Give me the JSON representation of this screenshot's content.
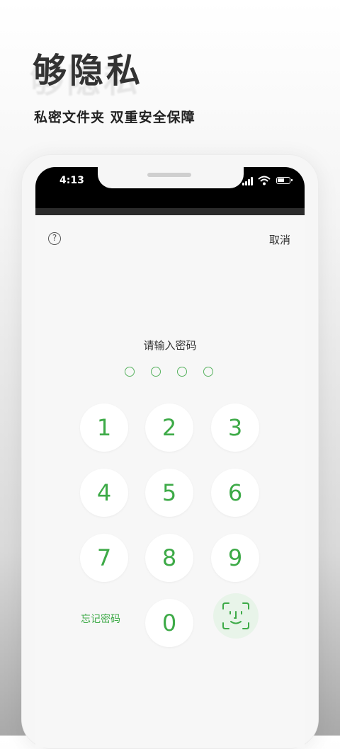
{
  "headline": {
    "title": "够隐私",
    "subtitle": "私密文件夹 双重安全保障"
  },
  "statusbar": {
    "time": "4:13"
  },
  "lock_screen": {
    "cancel_label": "取消",
    "help_symbol": "?",
    "prompt": "请输入密码",
    "pin_length": 4,
    "keys": [
      "1",
      "2",
      "3",
      "4",
      "5",
      "6",
      "7",
      "8",
      "9",
      "0"
    ],
    "forgot_label": "忘记密码",
    "accent_color": "#3daa47"
  },
  "icons": [
    "help-icon",
    "face-id-icon",
    "signal-icon",
    "wifi-icon",
    "battery-icon"
  ]
}
